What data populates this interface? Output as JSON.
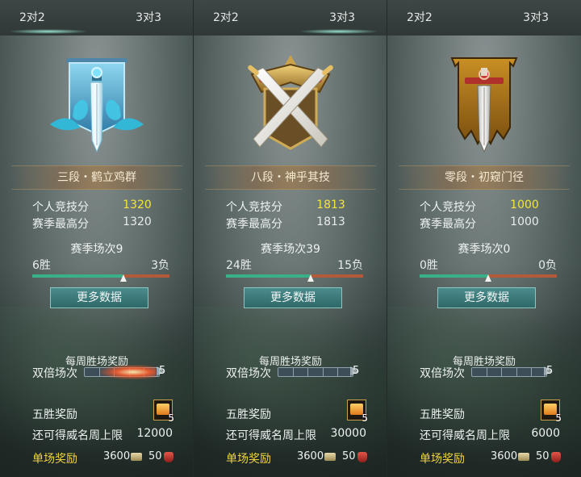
{
  "panels": [
    {
      "tabs": {
        "two": "2对2",
        "three": "3对3"
      },
      "active_tab": "two",
      "emblem_icon": "blue-banner-sword-emblem",
      "rank_title": "三段・鹤立鸡群",
      "personal_score_label": "个人竞技分",
      "personal_score": "1320",
      "season_high_label": "赛季最高分",
      "season_high": "1320",
      "season_matches": "赛季场次9",
      "wins": "6胜",
      "losses": "3负",
      "win_ratio": 0.667,
      "more_data": "更多数据",
      "weekly_title": "每周胜场奖励",
      "double_label": "双倍场次",
      "double_count": "5",
      "double_progress_active": true,
      "five_win_label": "五胜奖励",
      "five_win_count": "5",
      "fame_cap_label": "还可得威名周上限",
      "fame_cap": "12000",
      "single_label": "单场奖励",
      "single_fame": "3600",
      "single_bonus": "50"
    },
    {
      "tabs": {
        "two": "2对2",
        "three": "3对3"
      },
      "active_tab": "three",
      "emblem_icon": "golden-crown-crossed-swords-emblem",
      "rank_title": "八段・神乎其技",
      "personal_score_label": "个人竞技分",
      "personal_score": "1813",
      "season_high_label": "赛季最高分",
      "season_high": "1813",
      "season_matches": "赛季场次39",
      "wins": "24胜",
      "losses": "15负",
      "win_ratio": 0.615,
      "more_data": "更多数据",
      "weekly_title": "每周胜场奖励",
      "double_label": "双倍场次",
      "double_count": "5",
      "double_progress_active": false,
      "five_win_label": "五胜奖励",
      "five_win_count": "5",
      "fame_cap_label": "还可得威名周上限",
      "fame_cap": "30000",
      "single_label": "单场奖励",
      "single_fame": "3600",
      "single_bonus": "50"
    },
    {
      "tabs": {
        "two": "2对2",
        "three": "3对3"
      },
      "active_tab": null,
      "emblem_icon": "brown-banner-sword-emblem",
      "rank_title": "零段・初窥门径",
      "personal_score_label": "个人竞技分",
      "personal_score": "1000",
      "season_high_label": "赛季最高分",
      "season_high": "1000",
      "season_matches": "赛季场次0",
      "wins": "0胜",
      "losses": "0负",
      "win_ratio": 0.5,
      "more_data": "更多数据",
      "weekly_title": "每周胜场奖励",
      "double_label": "双倍场次",
      "double_count": "5",
      "double_progress_active": false,
      "five_win_label": "五胜奖励",
      "five_win_count": "5",
      "fame_cap_label": "还可得威名周上限",
      "fame_cap": "6000",
      "single_label": "单场奖励",
      "single_fame": "3600",
      "single_bonus": "50"
    }
  ],
  "colors": {
    "score_highlight": "#f4e53a",
    "single_reward_label": "#f0d246",
    "win_bar": "#3ab088",
    "loss_bar": "#b25a3a"
  }
}
